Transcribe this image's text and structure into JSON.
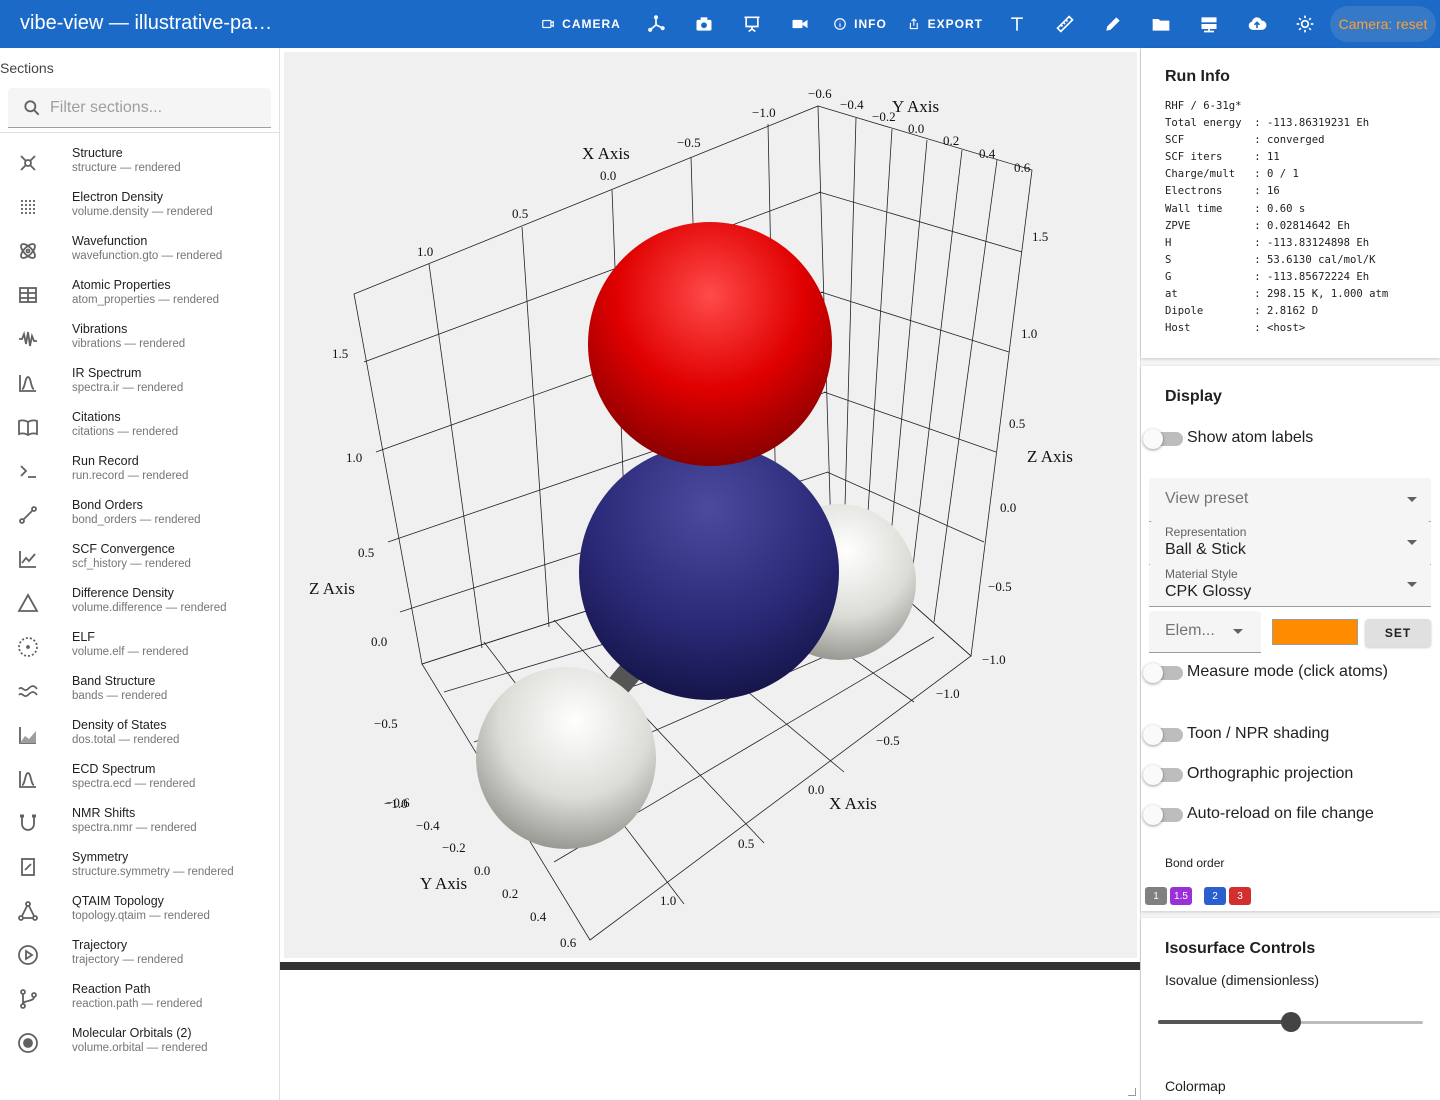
{
  "app": {
    "title": "vibe-view — illustrative-pan…"
  },
  "toolbar": {
    "camera_label": "CAMERA",
    "info_label": "INFO",
    "export_label": "EXPORT",
    "camera_reset_label": "Camera: reset",
    "icons": [
      "axes-icon",
      "camera-icon",
      "easel-icon",
      "video-icon",
      "text-icon",
      "ruler-icon",
      "pencil-icon",
      "folder-icon",
      "server-icon",
      "cloud-upload-icon",
      "brightness-icon"
    ]
  },
  "sidebar": {
    "heading": "Sections",
    "filter_placeholder": "Filter sections...",
    "items": [
      {
        "title": "Structure",
        "subtitle": "structure — rendered",
        "icon": "structure-icon"
      },
      {
        "title": "Electron Density",
        "subtitle": "volume.density — rendered",
        "icon": "dot-grid-icon"
      },
      {
        "title": "Wavefunction",
        "subtitle": "wavefunction.gto — rendered",
        "icon": "atom-icon"
      },
      {
        "title": "Atomic Properties",
        "subtitle": "atom_properties — rendered",
        "icon": "table-icon"
      },
      {
        "title": "Vibrations",
        "subtitle": "vibrations — rendered",
        "icon": "waveform-icon"
      },
      {
        "title": "IR Spectrum",
        "subtitle": "spectra.ir — rendered",
        "icon": "spectrum-icon"
      },
      {
        "title": "Citations",
        "subtitle": "citations — rendered",
        "icon": "book-icon"
      },
      {
        "title": "Run Record",
        "subtitle": "run.record — rendered",
        "icon": "terminal-icon"
      },
      {
        "title": "Bond Orders",
        "subtitle": "bond_orders — rendered",
        "icon": "bond-icon"
      },
      {
        "title": "SCF Convergence",
        "subtitle": "scf_history — rendered",
        "icon": "line-chart-icon"
      },
      {
        "title": "Difference Density",
        "subtitle": "volume.difference — rendered",
        "icon": "triangle-icon"
      },
      {
        "title": "ELF",
        "subtitle": "volume.elf — rendered",
        "icon": "dotted-circle-icon"
      },
      {
        "title": "Band Structure",
        "subtitle": "bands — rendered",
        "icon": "bands-icon"
      },
      {
        "title": "Density of States",
        "subtitle": "dos.total — rendered",
        "icon": "area-chart-icon"
      },
      {
        "title": "ECD Spectrum",
        "subtitle": "spectra.ecd — rendered",
        "icon": "spectrum-icon"
      },
      {
        "title": "NMR Shifts",
        "subtitle": "spectra.nmr — rendered",
        "icon": "magnet-icon"
      },
      {
        "title": "Symmetry",
        "subtitle": "structure.symmetry — rendered",
        "icon": "symmetry-icon"
      },
      {
        "title": "QTAIM Topology",
        "subtitle": "topology.qtaim — rendered",
        "icon": "graph-icon"
      },
      {
        "title": "Trajectory",
        "subtitle": "trajectory — rendered",
        "icon": "play-circle-icon"
      },
      {
        "title": "Reaction Path",
        "subtitle": "reaction.path — rendered",
        "icon": "branch-icon"
      },
      {
        "title": "Molecular Orbitals (2)",
        "subtitle": "volume.orbital — rendered",
        "icon": "orbital-icon"
      }
    ]
  },
  "viewer": {
    "axis_titles": {
      "x_back": "X Axis",
      "y_back": "Y Axis",
      "z_left": "Z Axis",
      "z_right": "Z Axis",
      "x_front": "X Axis",
      "y_front": "Y Axis"
    },
    "back_x_ticks": [
      "1.0",
      "0.5",
      "0.0",
      "−0.5",
      "−1.0"
    ],
    "back_y_ticks": [
      "−0.6",
      "−0.4",
      "−0.2",
      "0.0",
      "0.2",
      "0.4",
      "0.6"
    ],
    "left_z_ticks": [
      "1.5",
      "1.0",
      "0.5",
      "0.0",
      "−0.5",
      "−1.0"
    ],
    "right_z_ticks": [
      "1.5",
      "1.0",
      "0.5",
      "0.0",
      "−0.5",
      "−1.0"
    ],
    "front_x_ticks": [
      "−1.0",
      "−0.5",
      "0.0",
      "0.5",
      "1.0"
    ],
    "front_y_ticks": [
      "−0.6",
      "−0.4",
      "−0.2",
      "0.0",
      "0.2",
      "0.4",
      "0.6"
    ],
    "atom_colors": {
      "oxygen": "#e00000",
      "nitrogen": "#2b2a78",
      "hydrogen": "#e6e6e2"
    }
  },
  "run_info": {
    "title": "Run Info",
    "text": "RHF / 6-31g*\nTotal energy  : -113.86319231 Eh\nSCF           : converged\nSCF iters     : 11\nCharge/mult   : 0 / 1\nElectrons     : 16\nWall time     : 0.60 s\nZPVE          : 0.02814642 Eh\nH             : -113.83124898 Eh\nS             : 53.6130 cal/mol/K\nG             : -113.85672224 Eh\nat            : 298.15 K, 1.000 atm\nDipole        : 2.8162 D\nHost          : <host>"
  },
  "display": {
    "title": "Display",
    "show_atom_labels": "Show atom labels",
    "view_preset_placeholder": "View preset",
    "representation_label": "Representation",
    "representation_value": "Ball & Stick",
    "material_label": "Material Style",
    "material_value": "CPK Glossy",
    "element_placeholder": "Elem...",
    "element_color": "#ff8c00",
    "set_label": "SET",
    "measure_mode": "Measure mode (click atoms)",
    "toon_shading": "Toon / NPR shading",
    "orthographic": "Orthographic projection",
    "auto_reload": "Auto-reload on file change",
    "bond_order_label": "Bond order",
    "bond_orders": [
      {
        "label": "1",
        "color": "#808080"
      },
      {
        "label": "1.5",
        "color": "#9b30d9"
      },
      {
        "label": "2",
        "color": "#2b5fcf"
      },
      {
        "label": "3",
        "color": "#d32f2f"
      }
    ]
  },
  "isosurface": {
    "title": "Isosurface Controls",
    "isovalue_label": "Isovalue (dimensionless)",
    "isovalue_fraction": 0.5,
    "colormap_label": "Colormap"
  }
}
